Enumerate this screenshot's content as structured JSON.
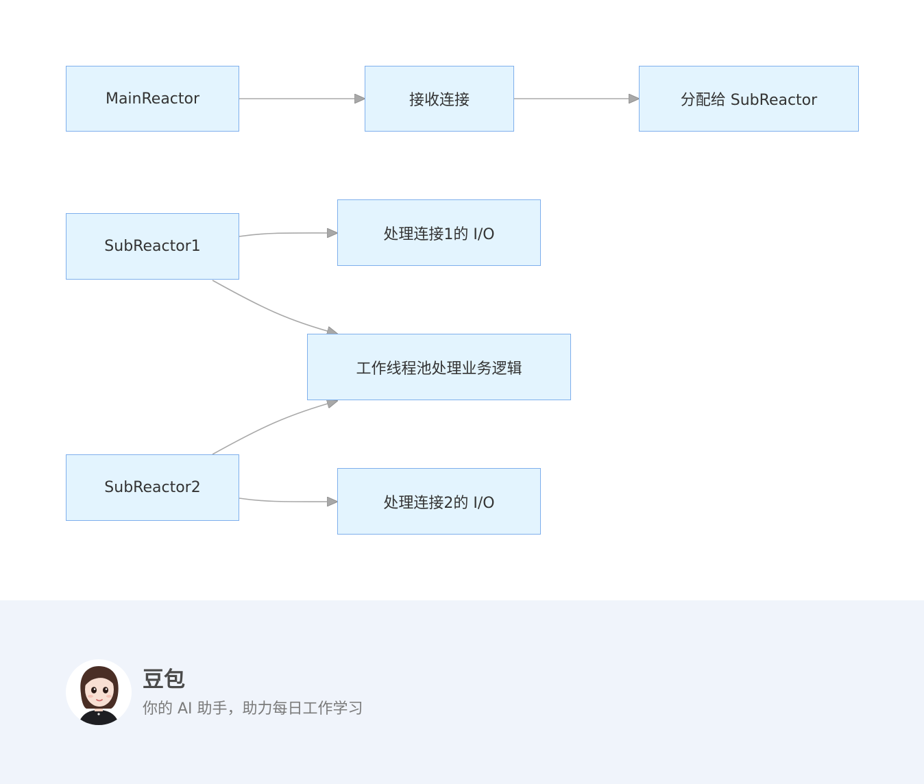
{
  "diagram": {
    "nodes": {
      "main_reactor": "MainReactor",
      "accept_connection": "接收连接",
      "dispatch": "分配给 SubReactor",
      "sub_reactor_1": "SubReactor1",
      "io_1": "处理连接1的 I/O",
      "worker_pool": "工作线程池处理业务逻辑",
      "sub_reactor_2": "SubReactor2",
      "io_2": "处理连接2的 I/O"
    },
    "edges": [
      {
        "from": "MainReactor",
        "to": "接收连接"
      },
      {
        "from": "接收连接",
        "to": "分配给 SubReactor"
      },
      {
        "from": "SubReactor1",
        "to": "处理连接1的 I/O"
      },
      {
        "from": "SubReactor1",
        "to": "工作线程池处理业务逻辑"
      },
      {
        "from": "SubReactor2",
        "to": "工作线程池处理业务逻辑"
      },
      {
        "from": "SubReactor2",
        "to": "处理连接2的 I/O"
      }
    ],
    "colors": {
      "node_fill": "#e3f4fe",
      "node_border": "#7daeec",
      "edge": "#a8a8a8"
    }
  },
  "footer": {
    "name": "豆包",
    "tagline": "你的 AI 助手，助力每日工作学习",
    "avatar_icon": "doubao-avatar-icon",
    "background": "#f0f4fb"
  }
}
